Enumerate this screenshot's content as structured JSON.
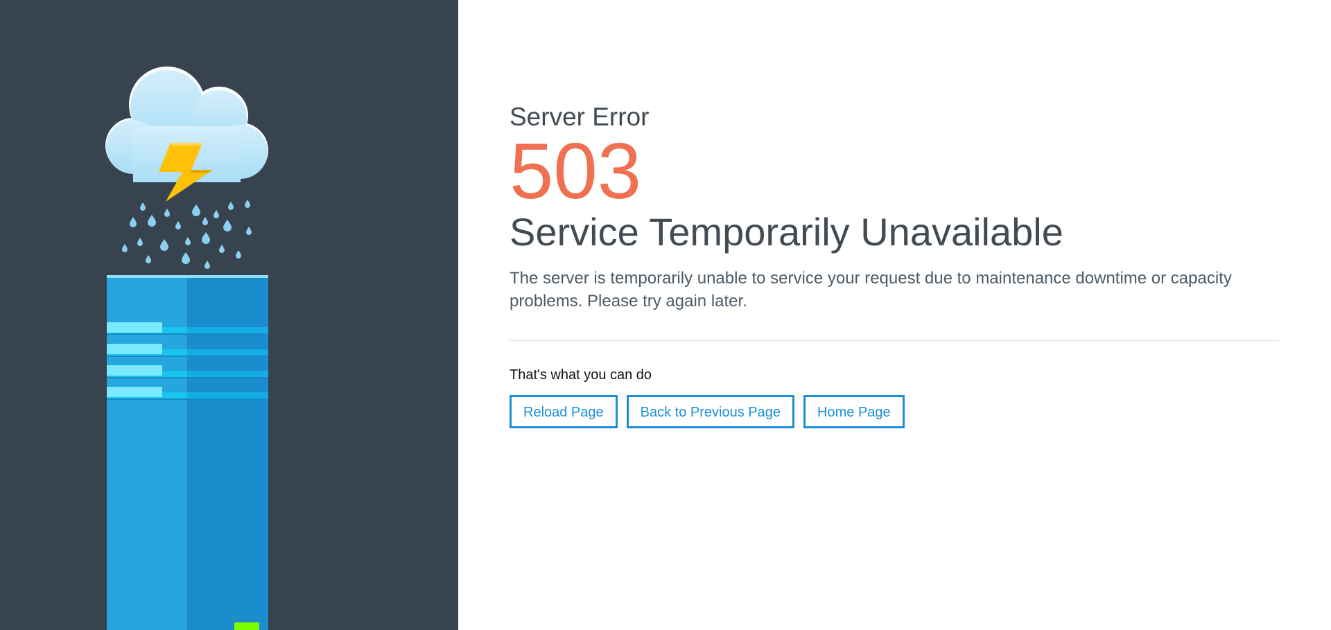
{
  "error": {
    "label": "Server Error",
    "code": "503",
    "title": "Service Temporarily Unavailable",
    "description": "The server is temporarily unable to service your request due to maintenance downtime or capacity problems. Please try again later."
  },
  "actions": {
    "heading": "That's what you can do",
    "reload_label": "Reload Page",
    "back_label": "Back to Previous Page",
    "home_label": "Home Page"
  },
  "illustration": {
    "icons": [
      "cloud-icon",
      "lightning-icon",
      "raindrop-icon",
      "server-rack-icon",
      "status-light-icon"
    ]
  },
  "colors": {
    "panel_background": "#37434f",
    "error_code": "#ef7152",
    "button_accent": "#1b8fd6",
    "cloud": "#b6e3f8",
    "lightning": "#ffc107",
    "raindrop": "#8bd0f0",
    "server_light": "#25a6de",
    "server_dark": "#1b8ccc",
    "server_stripe": "#16c6ef",
    "server_tab": "#7ae9fb",
    "status_light": "#7cfc00"
  }
}
